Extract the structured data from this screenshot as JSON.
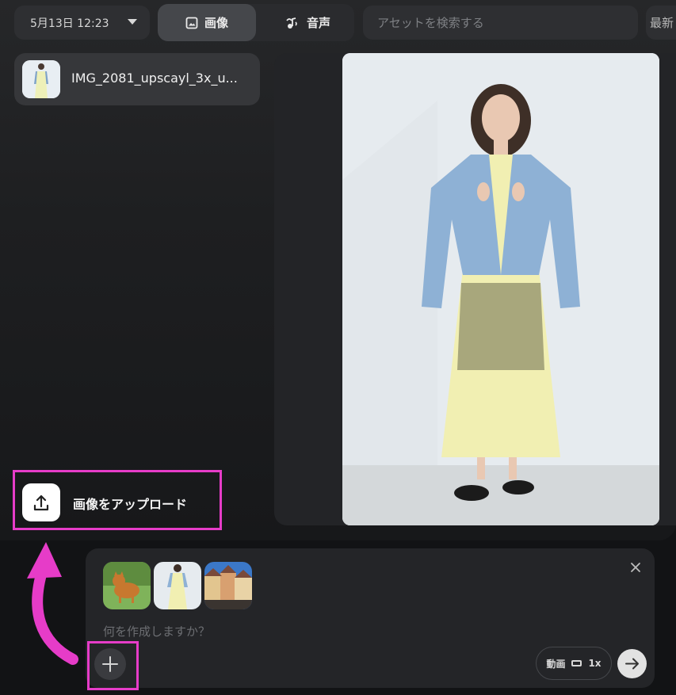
{
  "header": {
    "date_selector": "5月13日 12:23",
    "tabs": [
      {
        "label": "画像",
        "icon": "image-icon",
        "active": true
      },
      {
        "label": "音声",
        "icon": "audio-icon",
        "active": false
      }
    ],
    "search_placeholder": "アセットを検索する",
    "sort_label": "最新"
  },
  "assets": [
    {
      "name": "IMG_2081_upscayl_3x_u..."
    }
  ],
  "upload": {
    "label": "画像をアップロード"
  },
  "composer": {
    "thumbnails": [
      "shiba-dog-thumbnail",
      "woman-yellow-dress-thumbnail",
      "european-town-thumbnail"
    ],
    "prompt_placeholder": "何を作成しますか？",
    "mode_label": "動画",
    "mode_speed": "1x"
  },
  "colors": {
    "highlight": "#e63cc8",
    "panel": "#242528",
    "active_tab": "#45474b"
  }
}
